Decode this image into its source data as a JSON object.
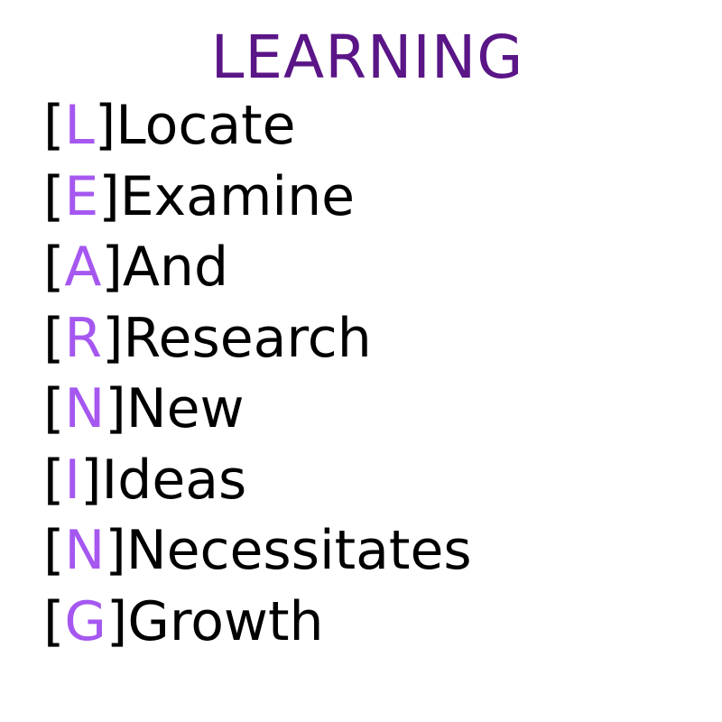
{
  "colors": {
    "title": "#5a1587",
    "letter": "#a557f0",
    "text": "#000000",
    "background": "#ffffff"
  },
  "title": "LEARNING",
  "rows": [
    {
      "letter": "L",
      "word": "Locate"
    },
    {
      "letter": "E",
      "word": "Examine"
    },
    {
      "letter": "A",
      "word": "And"
    },
    {
      "letter": "R",
      "word": "Research"
    },
    {
      "letter": "N",
      "word": "New"
    },
    {
      "letter": "I",
      "word": "Ideas"
    },
    {
      "letter": "N",
      "word": "Necessitates"
    },
    {
      "letter": "G",
      "word": "Growth"
    }
  ]
}
